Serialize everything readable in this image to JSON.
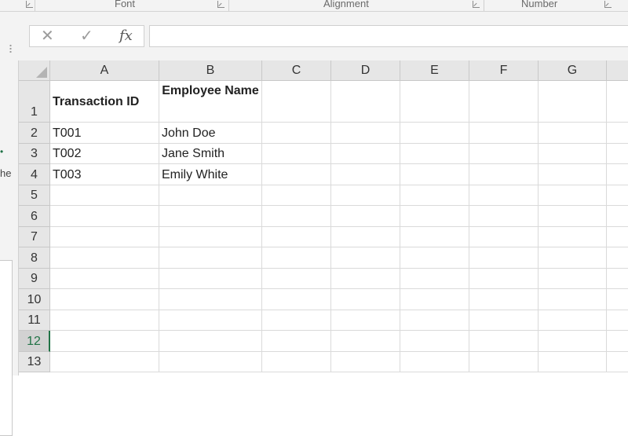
{
  "ribbon": {
    "groups": [
      "Font",
      "Alignment",
      "Number"
    ]
  },
  "formula_bar": {
    "cancel_icon": "✕",
    "enter_icon": "✓",
    "function_icon": "fx",
    "value": ""
  },
  "left_pane": {
    "text": "he"
  },
  "sheet": {
    "columns": [
      "A",
      "B",
      "C",
      "D",
      "E",
      "F",
      "G"
    ],
    "rows": [
      "1",
      "2",
      "3",
      "4",
      "5",
      "6",
      "7",
      "8",
      "9",
      "10",
      "11",
      "12",
      "13"
    ],
    "active_row": "12",
    "headers": {
      "a1": "Transaction ID",
      "b1": "Employee Name"
    },
    "data": [
      {
        "id": "T001",
        "name": "John Doe"
      },
      {
        "id": "T002",
        "name": "Jane Smith"
      },
      {
        "id": "T003",
        "name": "Emily White"
      }
    ]
  },
  "colors": {
    "accent": "#217346",
    "header_bg": "#e6e6e6",
    "gridline": "#dadada"
  }
}
